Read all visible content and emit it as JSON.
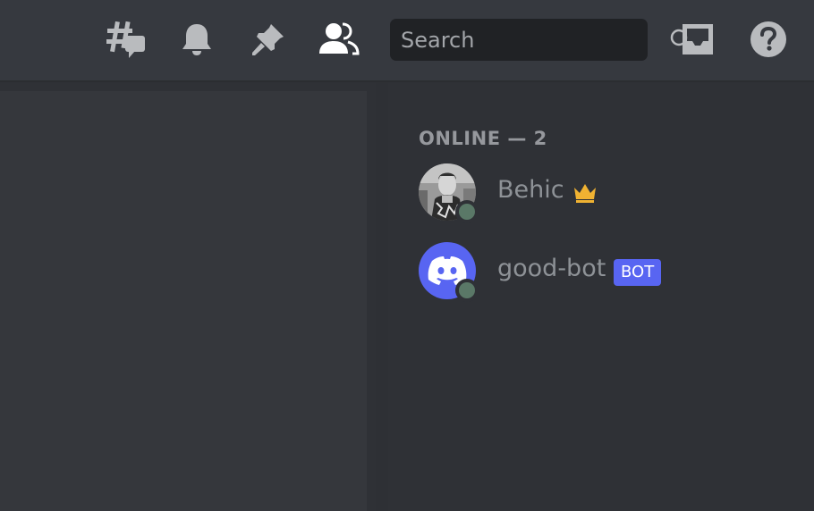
{
  "header": {
    "icons": [
      {
        "name": "threads-icon"
      },
      {
        "name": "bell-icon"
      },
      {
        "name": "pin-icon"
      },
      {
        "name": "members-icon"
      }
    ],
    "search": {
      "placeholder": "Search"
    },
    "right_icons": [
      {
        "name": "inbox-icon"
      },
      {
        "name": "help-icon"
      }
    ]
  },
  "members": {
    "section_label": "ONLINE — 2",
    "list": [
      {
        "name": "Behic",
        "badge_icon": "crown-icon",
        "status": "online"
      },
      {
        "name": "good-bot",
        "tag": "BOT",
        "status": "online"
      }
    ]
  },
  "colors": {
    "background": "#36393f",
    "panel": "#2f3136",
    "search_bg": "#202225",
    "accent": "#5865f2",
    "status_online": "#5a7867",
    "crown": "#f0b232"
  }
}
